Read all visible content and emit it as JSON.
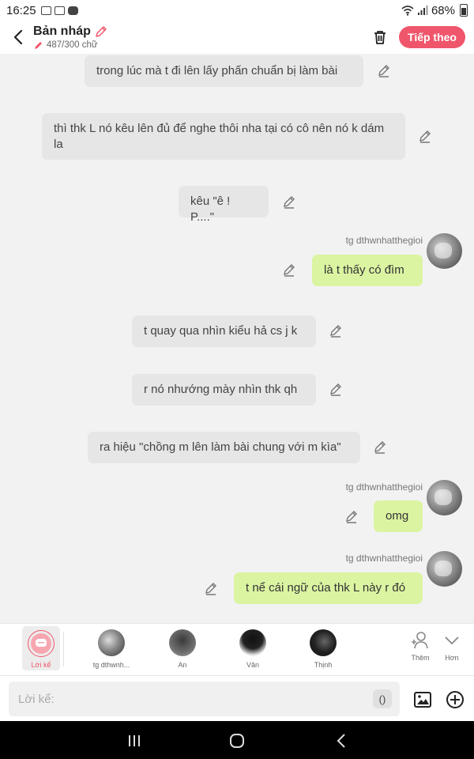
{
  "status_bar": {
    "time": "16:25",
    "battery": "68%"
  },
  "header": {
    "title": "Bản nháp",
    "word_count": "487/300 chữ",
    "next_label": "Tiếp theo",
    "accent": "#f0566b"
  },
  "messages": [
    {
      "type": "narration",
      "text": "trong lúc mà t đi lên lấy phấn chuẩn bị làm bài"
    },
    {
      "type": "narration",
      "text": "thì thk L nó kêu lên đủ để nghe thôi nha tại có cô nên nó k dám la"
    },
    {
      "type": "narration",
      "text": "kêu \"ê ! P....\""
    },
    {
      "type": "dialogue",
      "speaker": "tg dthwnhatthegioi",
      "text": "là t thấy có đìm"
    },
    {
      "type": "narration",
      "text": "t quay qua nhìn kiểu hả cs j k"
    },
    {
      "type": "narration",
      "text": "r nó nhướng mày nhìn thk qh"
    },
    {
      "type": "narration",
      "text": "ra hiệu \"chồng m lên làm bài chung với m kìa\""
    },
    {
      "type": "dialogue",
      "speaker": "tg dthwnhatthegioi",
      "text": "omg"
    },
    {
      "type": "dialogue",
      "speaker": "tg dthwnhatthegioi",
      "text": "t nể cái ngữ của thk L này r đó"
    }
  ],
  "characters": {
    "narrator_label": "Lời kể",
    "items": [
      {
        "label": "tg dthwnh..."
      },
      {
        "label": "An"
      },
      {
        "label": "Vân"
      },
      {
        "label": "Thịnh"
      }
    ],
    "add_label": "Thêm",
    "more_label": "Hơn"
  },
  "input": {
    "placeholder": "Lời kể:",
    "paren_label": "()"
  }
}
